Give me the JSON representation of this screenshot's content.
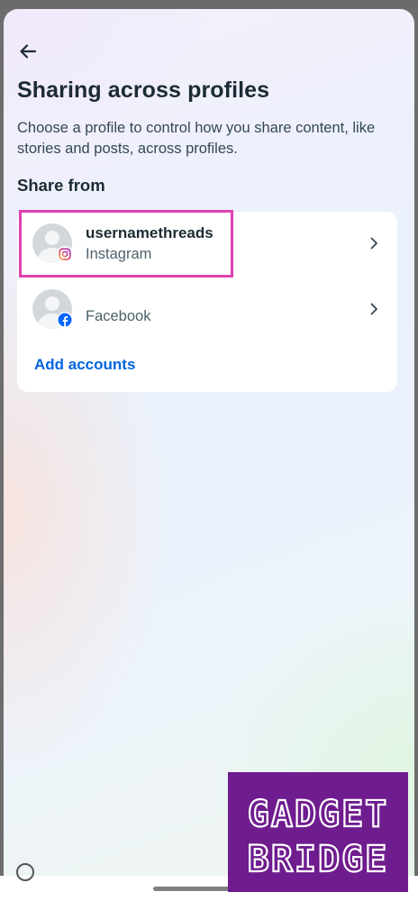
{
  "header": {
    "back_icon": "arrow-left-icon",
    "title": "Sharing across profiles",
    "description": "Choose a profile to control how you share content, like stories and posts, across profiles."
  },
  "share_from": {
    "label": "Share from",
    "accounts": [
      {
        "username": "usernamethreads",
        "platform": "Instagram",
        "badge_icon": "instagram-icon",
        "chevron_icon": "chevron-right-icon"
      },
      {
        "username": "",
        "platform": "Facebook",
        "badge_icon": "facebook-icon",
        "chevron_icon": "chevron-right-icon"
      }
    ],
    "add_accounts": "Add accounts"
  },
  "watermark": {
    "line1": "GADGET",
    "line2": "BRIDGE"
  },
  "colors": {
    "accent_link": "#0064e0",
    "highlight_border": "#e040b0",
    "watermark_bg": "#6e1c8e",
    "text_primary": "#1c2b33"
  }
}
